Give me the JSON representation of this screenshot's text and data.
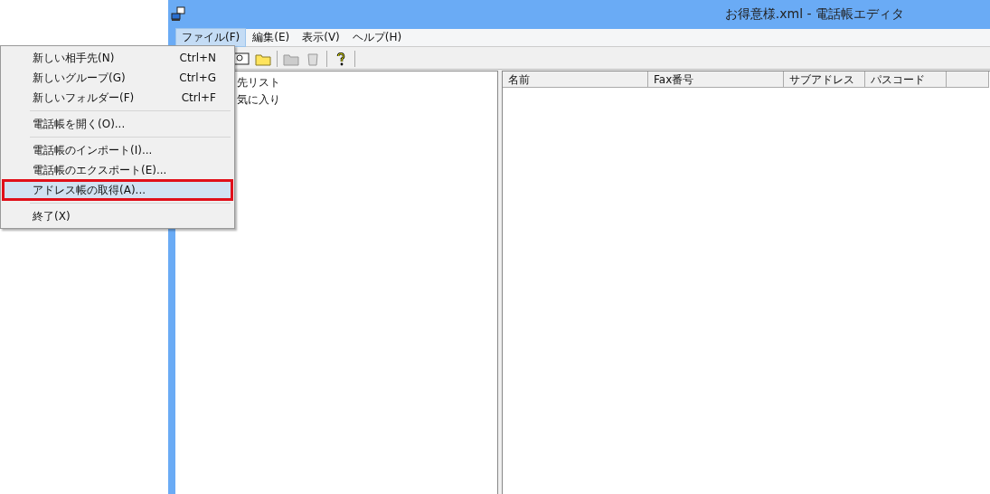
{
  "window": {
    "title": "お得意様.xml - 電話帳エディタ"
  },
  "menu_bar": [
    {
      "label": "ファイル(F)",
      "selected": true
    },
    {
      "label": "編集(E)",
      "selected": false
    },
    {
      "label": "表示(V)",
      "selected": false
    },
    {
      "label": "ヘルプ(H)",
      "selected": false
    }
  ],
  "file_menu": {
    "items": [
      {
        "kind": "item",
        "label": "新しい相手先(N)",
        "shortcut": "Ctrl+N",
        "selected": false
      },
      {
        "kind": "item",
        "label": "新しいグループ(G)",
        "shortcut": "Ctrl+G",
        "selected": false
      },
      {
        "kind": "item",
        "label": "新しいフォルダー(F)",
        "shortcut": "Ctrl+F",
        "selected": false
      },
      {
        "kind": "separator"
      },
      {
        "kind": "item",
        "label": "電話帳を開く(O)...",
        "selected": false
      },
      {
        "kind": "separator"
      },
      {
        "kind": "item",
        "label": "電話帳のインポート(I)...",
        "selected": false
      },
      {
        "kind": "item",
        "label": "電話帳のエクスポート(E)...",
        "selected": false
      },
      {
        "kind": "item",
        "label": "アドレス帳の取得(A)...",
        "selected": true
      },
      {
        "kind": "separator"
      },
      {
        "kind": "item",
        "label": "終了(X)",
        "selected": false
      }
    ]
  },
  "tree": {
    "items": [
      {
        "label": "先リスト"
      },
      {
        "label": "気に入り"
      }
    ]
  },
  "list": {
    "columns": [
      "名前",
      "Fax番号",
      "サブアドレス",
      "パスコード"
    ]
  }
}
